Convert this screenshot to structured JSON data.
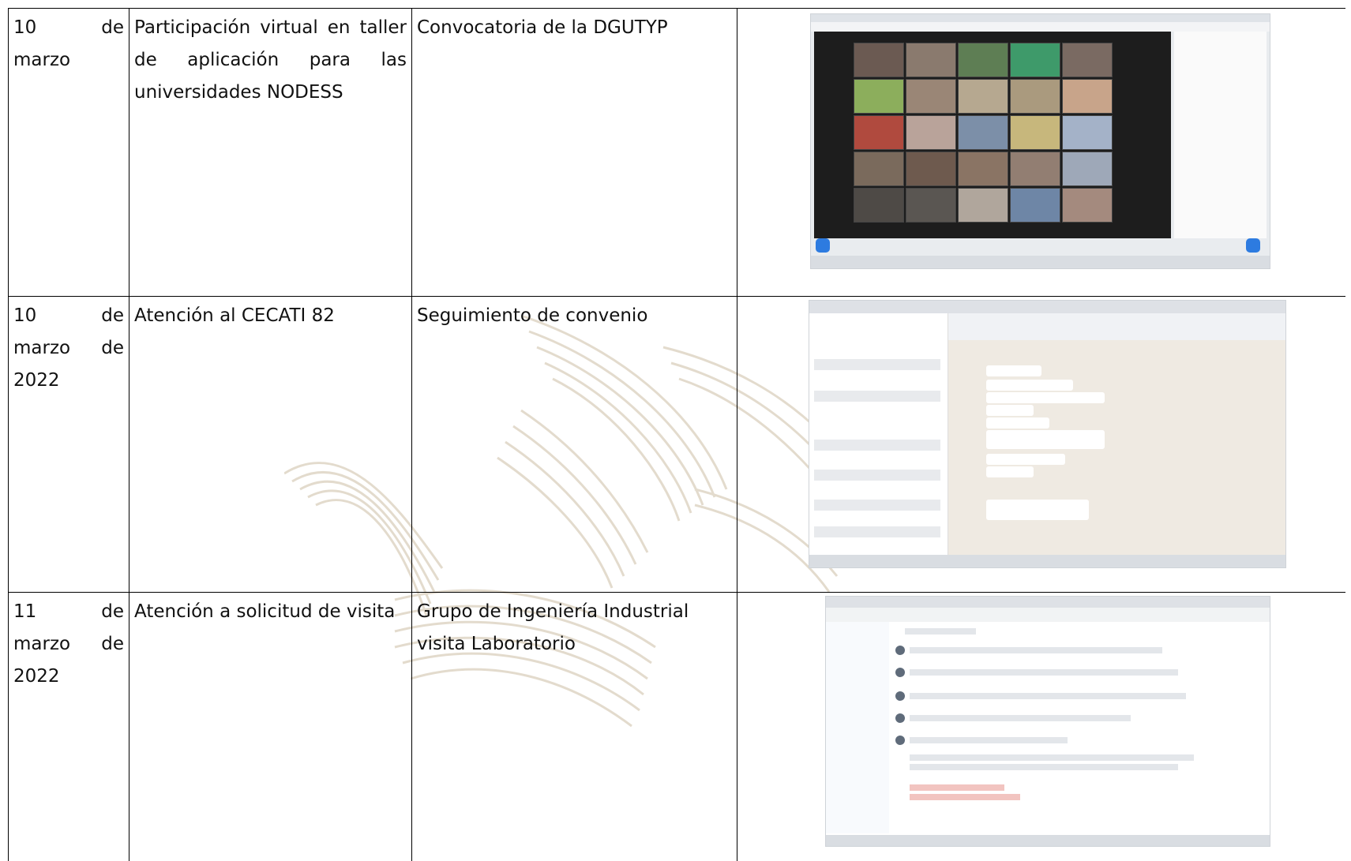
{
  "rows": [
    {
      "date": [
        "10",
        "de",
        "marzo"
      ],
      "activity": "Participación virtual en taller de aplicación para las universidades NODESS",
      "description": "Convocatoria de la DGUTYP",
      "evidence_icon": "zoom-meeting-screenshot"
    },
    {
      "date": [
        "10",
        "de",
        "marzo",
        "de",
        "2022"
      ],
      "activity": "Atención al CECATI 82",
      "description": "Seguimiento de convenio",
      "evidence_icon": "whatsapp-chat-screenshot"
    },
    {
      "date": [
        "11",
        "de",
        "marzo",
        "de",
        "2022"
      ],
      "activity": "Atención a solicitud de visita",
      "description": "Grupo de Ingeniería Industrial visita Laboratorio",
      "evidence_icon": "gmail-thread-screenshot"
    }
  ],
  "colors": {
    "border": "#000000",
    "watermark": "#c8b89c",
    "zoom_stage": "#1d1d1d",
    "whatsapp_bg": "#efeae2"
  }
}
